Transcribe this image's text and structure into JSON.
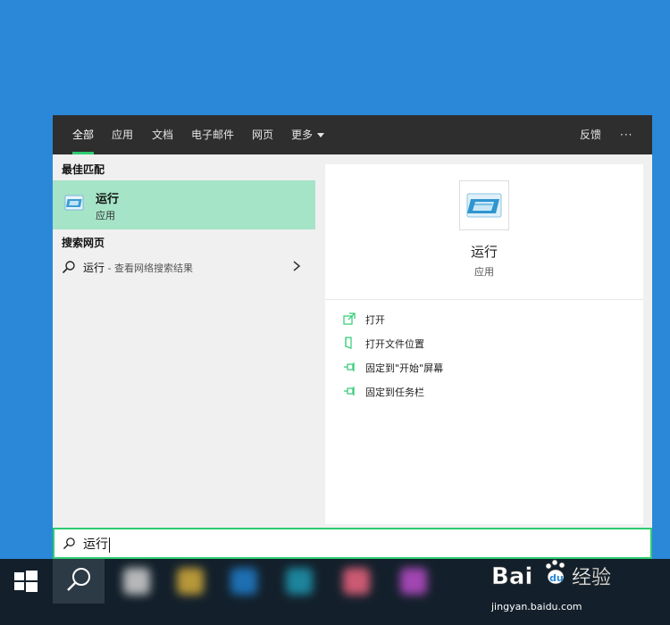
{
  "tabs": [
    {
      "label": "全部",
      "active": true
    },
    {
      "label": "应用"
    },
    {
      "label": "文档"
    },
    {
      "label": "电子邮件"
    },
    {
      "label": "网页"
    },
    {
      "label": "更多"
    }
  ],
  "topbar_right": {
    "feedback": "反馈",
    "more": "···"
  },
  "left": {
    "best_match_header": "最佳匹配",
    "best_match": {
      "title": "运行",
      "subtitle": "应用",
      "icon": "run-app-icon"
    },
    "web_header": "搜索网页",
    "web_result": {
      "query": "运行",
      "hint": " - 查看网络搜索结果"
    }
  },
  "detail": {
    "title": "运行",
    "subtitle": "应用",
    "actions": [
      {
        "label": "打开",
        "icon": "open-icon"
      },
      {
        "label": "打开文件位置",
        "icon": "file-location-icon"
      },
      {
        "label": "固定到\"开始\"屏幕",
        "icon": "pin-icon"
      },
      {
        "label": "固定到任务栏",
        "icon": "pin-icon"
      }
    ]
  },
  "search": {
    "value": "运行"
  },
  "taskbar": {
    "apps": [
      "#c8c8c8",
      "#c9a43a",
      "#1f78c1",
      "#1e8fa8",
      "#e0607a",
      "#b04ac0"
    ]
  },
  "watermark": {
    "brand": "Bai",
    "paw": "du",
    "suffix": "经验",
    "url": "jingyan.baidu.com"
  },
  "colors": {
    "accent": "#2ecc71",
    "desktop": "#2b88d8",
    "selection": "#a5e4c7",
    "topbar": "#2e2e2e"
  }
}
